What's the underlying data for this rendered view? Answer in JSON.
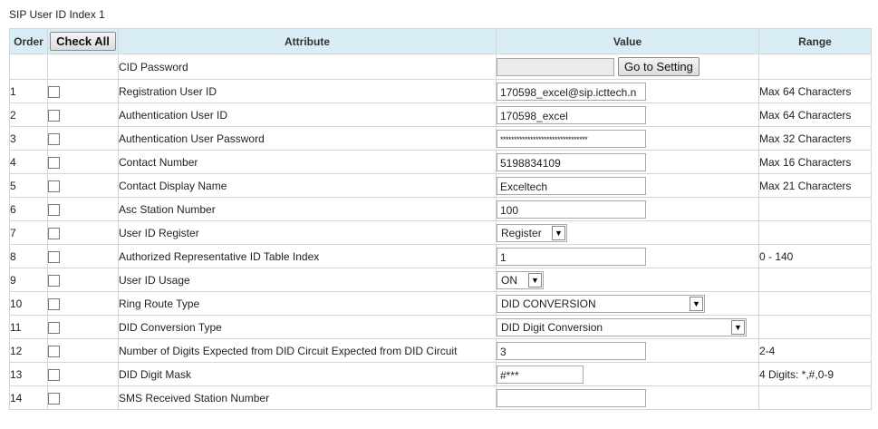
{
  "page_title": "SIP User ID Index 1",
  "header": {
    "order": "Order",
    "check_all": "Check All",
    "attribute": "Attribute",
    "value": "Value",
    "range": "Range"
  },
  "cid_row": {
    "attribute": "CID Password",
    "value": "",
    "button": "Go to Setting"
  },
  "rows": [
    {
      "order": "1",
      "attribute": "Registration User ID",
      "value": "170598_excel@sip.icttech.n",
      "range": "Max 64 Characters"
    },
    {
      "order": "2",
      "attribute": "Authentication User ID",
      "value": "170598_excel",
      "range": "Max 64 Characters"
    },
    {
      "order": "3",
      "attribute": "Authentication User Password",
      "value": "********************************",
      "range": "Max 32 Characters"
    },
    {
      "order": "4",
      "attribute": "Contact Number",
      "value": "5198834109",
      "range": "Max 16 Characters"
    },
    {
      "order": "5",
      "attribute": "Contact Display Name",
      "value": "Exceltech",
      "range": "Max 21 Characters"
    },
    {
      "order": "6",
      "attribute": "Asc Station Number",
      "value": "100",
      "range": ""
    },
    {
      "order": "7",
      "attribute": "User ID Register",
      "value": "Register",
      "range": ""
    },
    {
      "order": "8",
      "attribute": "Authorized Representative ID Table Index",
      "value": "1",
      "range": "0 - 140"
    },
    {
      "order": "9",
      "attribute": "User ID Usage",
      "value": "ON",
      "range": ""
    },
    {
      "order": "10",
      "attribute": "Ring Route Type",
      "value": "DID CONVERSION",
      "range": ""
    },
    {
      "order": "11",
      "attribute": "DID Conversion Type",
      "value": "DID Digit Conversion",
      "range": ""
    },
    {
      "order": "12",
      "attribute": "Number of Digits Expected from DID Circuit Expected from DID Circuit",
      "value": "3",
      "range": "2-4"
    },
    {
      "order": "13",
      "attribute": "DID Digit Mask",
      "value": "#***",
      "range": "4 Digits: *,#,0-9"
    },
    {
      "order": "14",
      "attribute": "SMS Received Station Number",
      "value": "",
      "range": ""
    }
  ],
  "icons": {
    "dropdown_arrow": "chevron-down-icon",
    "checkbox": "checkbox-icon"
  },
  "colors": {
    "header_bg": "#d9edf7",
    "border": "#cfd7dd"
  }
}
